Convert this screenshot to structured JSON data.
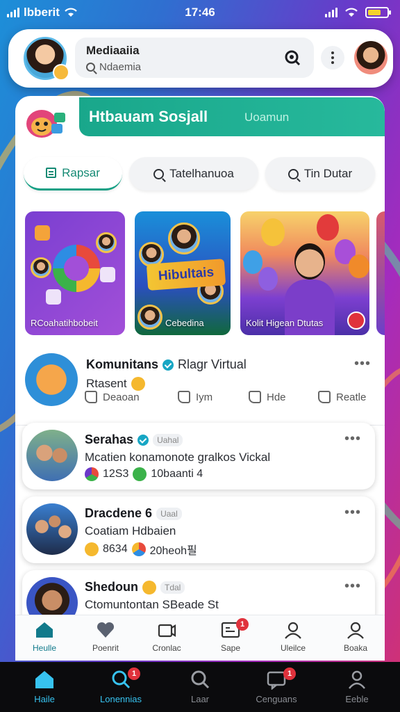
{
  "status_bar": {
    "carrier": "lbberit",
    "time": "17:46"
  },
  "header": {
    "app_name": "Mediaaiia",
    "search_placeholder": "Ndaemia"
  },
  "main": {
    "banner_title": "Htbauam Sosjall",
    "banner_sub": "Uoamun",
    "tabs": [
      {
        "label": "Rapsar",
        "active": true
      },
      {
        "label": "Tatelhanuoa",
        "active": false
      },
      {
        "label": "Tin Dutar",
        "active": false
      }
    ],
    "stories": [
      {
        "caption": "RCoahatihbobeit"
      },
      {
        "caption": "Cebedina",
        "banner": "Hibultais"
      },
      {
        "caption": "Kolit Higean Dtutas"
      }
    ],
    "featured_post": {
      "name": "Komunitans",
      "name_extra": "Rlagr Virtual",
      "text": "Rtasent",
      "actions": [
        "Deaoan",
        "Iym",
        "Hde",
        "Reatle"
      ],
      "more": "•••"
    },
    "feed": [
      {
        "name": "Serahas",
        "tag": "Uahal",
        "text": "Mcatien konamonote gralkos Vickal",
        "stat1": "12S3",
        "stat2": "10baanti 4",
        "more": "•••"
      },
      {
        "name": "Dracdene 6",
        "tag": "Uaal",
        "text": "Coatiam Hdbaien",
        "stat1": "8634",
        "stat2": "20heoh필",
        "more": "•••"
      },
      {
        "name": "Shedoun",
        "tag": "Tdal",
        "text": "Ctomuntontan SBeade St",
        "more": "•••"
      }
    ]
  },
  "card_nav": [
    {
      "label": "Heulle",
      "icon": "home-icon",
      "active": true
    },
    {
      "label": "Poenrit",
      "icon": "heart-icon"
    },
    {
      "label": "Cronlac",
      "icon": "media-icon"
    },
    {
      "label": "Sape",
      "icon": "gallery-icon",
      "badge": "1"
    },
    {
      "label": "Uleilce",
      "icon": "person-icon"
    },
    {
      "label": "Boaka",
      "icon": "profile-icon"
    }
  ],
  "bottom_nav": [
    {
      "label": "Haile",
      "icon": "home-icon",
      "active": true
    },
    {
      "label": "Lonennias",
      "icon": "search-icon",
      "badge": "1"
    },
    {
      "label": "Laar",
      "icon": "search-icon"
    },
    {
      "label": "Cenguans",
      "icon": "chat-icon",
      "badge": "1"
    },
    {
      "label": "Eeble",
      "icon": "profile-icon"
    }
  ],
  "colors": {
    "accent": "#16a085",
    "active_nav": "#37c3f0",
    "badge": "#e0323c"
  }
}
